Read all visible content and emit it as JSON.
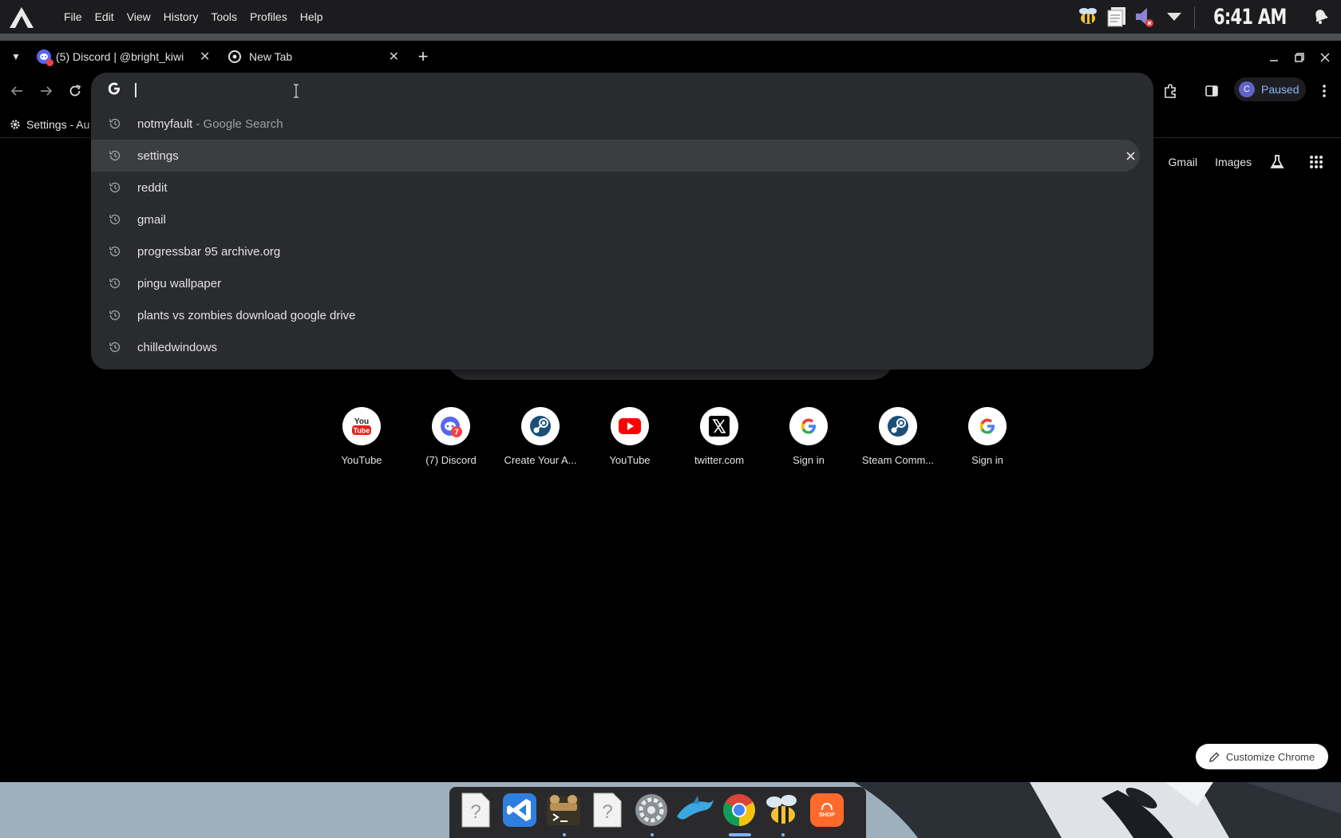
{
  "menubar": {
    "items": [
      "File",
      "Edit",
      "View",
      "History",
      "Tools",
      "Profiles",
      "Help"
    ],
    "clock": "6:41 AM"
  },
  "tabs": [
    {
      "title": "(5) Discord | @bright_kiwi",
      "icon": "discord-icon"
    },
    {
      "title": "New Tab",
      "icon": "chrome-icon"
    }
  ],
  "toolbar": {
    "profile_initial": "C",
    "profile_status": "Paused"
  },
  "bookmarks": [
    {
      "label": "Settings - Au",
      "icon": "gear-icon"
    }
  ],
  "omnibox": {
    "value": "",
    "suggestions": [
      {
        "text": "notmyfault",
        "suffix": " - Google Search"
      },
      {
        "text": "settings",
        "suffix": ""
      },
      {
        "text": "reddit",
        "suffix": ""
      },
      {
        "text": "gmail",
        "suffix": ""
      },
      {
        "text": "progressbar 95 archive.org",
        "suffix": ""
      },
      {
        "text": "pingu wallpaper",
        "suffix": ""
      },
      {
        "text": "plants vs zombies download google drive",
        "suffix": ""
      },
      {
        "text": "chilledwindows",
        "suffix": ""
      }
    ],
    "selected_index": 1
  },
  "ntp": {
    "links": [
      "Gmail",
      "Images"
    ],
    "shortcuts": [
      {
        "label": "YouTube",
        "icon": "youtube-classic-icon"
      },
      {
        "label": "(7) Discord",
        "icon": "discord-icon"
      },
      {
        "label": "Create Your A...",
        "icon": "steam-icon"
      },
      {
        "label": "YouTube",
        "icon": "youtube-icon"
      },
      {
        "label": "twitter.com",
        "icon": "x-icon"
      },
      {
        "label": "Sign in",
        "icon": "google-icon"
      },
      {
        "label": "Steam Comm...",
        "icon": "steam-icon"
      },
      {
        "label": "Sign in",
        "icon": "google-icon"
      }
    ],
    "customize_label": "Customize Chrome"
  },
  "dock": {
    "apps": [
      "unknown-file-icon",
      "vscode-icon",
      "terminal-icon",
      "unknown-file-icon",
      "settings-icon",
      "dolphin-icon",
      "chrome-icon",
      "bee-icon",
      "shop-icon"
    ],
    "shop_label": "SHOP"
  },
  "colors": {
    "accent": "#8ab4f8",
    "omnibox_bg": "#2a2b2e",
    "selected_row": "#3c3d40"
  }
}
